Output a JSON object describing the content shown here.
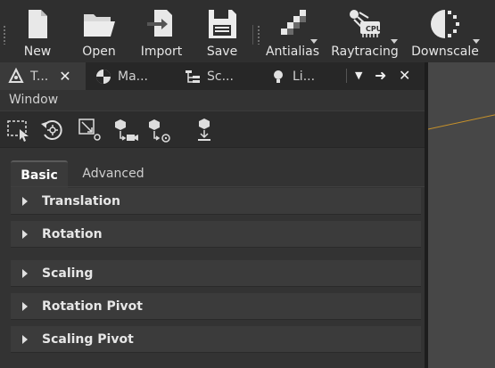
{
  "toolbar": {
    "new_label": "New",
    "open_label": "Open",
    "import_label": "Import",
    "save_label": "Save",
    "antialias_label": "Antialias",
    "raytracing_label": "Raytracing",
    "raytracing_badge": "CPU",
    "downscale_label": "Downscale"
  },
  "tabs": [
    {
      "label": "T...",
      "icon": "transform-icon"
    },
    {
      "label": "Ma...",
      "icon": "material-icon"
    },
    {
      "label": "Sc...",
      "icon": "scene-icon"
    },
    {
      "label": "Li...",
      "icon": "light-icon"
    }
  ],
  "panel": {
    "window_label": "Window",
    "subtabs": [
      "Basic",
      "Advanced"
    ],
    "active_subtab": "Basic",
    "sections": [
      "Translation",
      "Rotation",
      "Scaling",
      "Rotation Pivot",
      "Scaling Pivot"
    ]
  },
  "colors": {
    "toolbar_bg": "#2f2f2f",
    "panel_bg": "#333333",
    "section_bg": "#3b3b3b",
    "viewport_bg": "#474747",
    "viewport_line": "#c8922a"
  }
}
